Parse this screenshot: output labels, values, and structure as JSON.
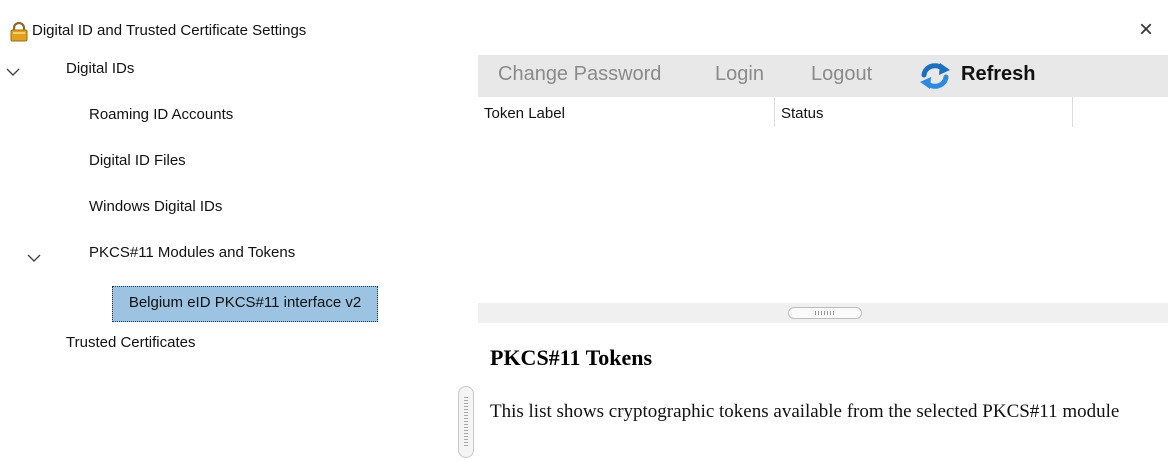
{
  "window": {
    "title": "Digital ID and Trusted Certificate Settings",
    "close_glyph": "×",
    "title_icon": "lock-icon",
    "close_icon": "close-icon"
  },
  "tree": {
    "digital_ids": "Digital IDs",
    "roaming": "Roaming ID Accounts",
    "files": "Digital ID Files",
    "windows": "Windows Digital IDs",
    "pkcs11": "PKCS#11 Modules and Tokens",
    "selected_module": "Belgium eID PKCS#11 interface v2",
    "trusted": "Trusted Certificates",
    "expand_icon": "chevron-down-icon",
    "selection_color": "#9cc3e1"
  },
  "toolbar": {
    "change_password": "Change Password",
    "login": "Login",
    "logout": "Logout",
    "refresh": "Refresh",
    "refresh_icon": "refresh-icon",
    "disabled_color": "#8a8a8a"
  },
  "token_list": {
    "columns": [
      "Token Label",
      "Status"
    ],
    "rows": []
  },
  "info": {
    "title": "PKCS#11 Tokens",
    "description": "This list shows cryptographic tokens available from the selected PKCS#11 module"
  }
}
